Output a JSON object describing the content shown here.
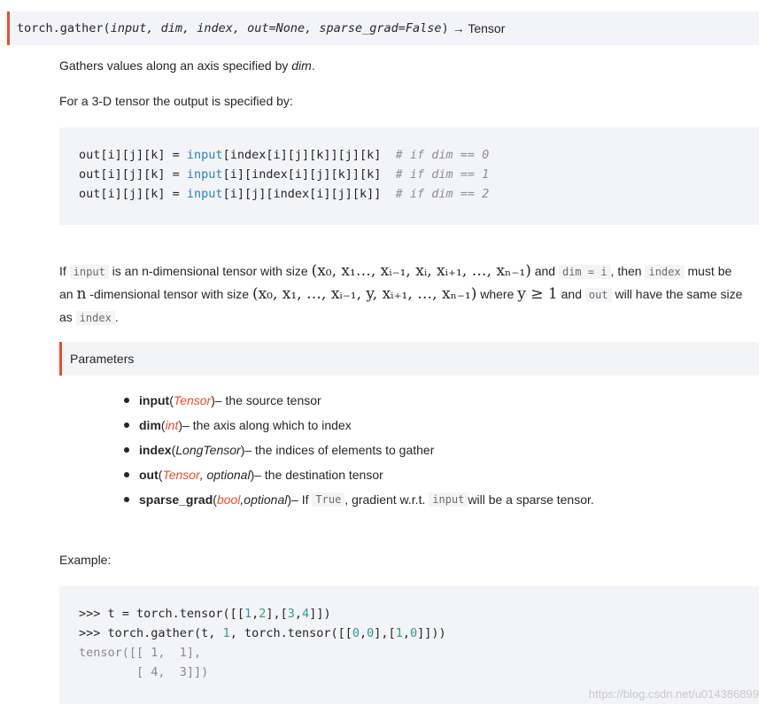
{
  "signature": {
    "name": "torch.gather",
    "open": "(",
    "args": "input, dim, index, out=None, sparse_grad=False",
    "close": ")",
    "returns": "→ Tensor"
  },
  "desc1_prefix": "Gathers values along an axis specified by ",
  "desc1_dim": "dim",
  "desc1_suffix": ".",
  "desc2": "For a 3-D tensor the output is specified by:",
  "code1": [
    {
      "lhs": "out[i][j][k] = ",
      "fn": "input",
      "rest": "[index[i][j][k]][j][k]  ",
      "comment": "# if dim == 0"
    },
    {
      "lhs": "out[i][j][k] = ",
      "fn": "input",
      "rest": "[i][index[i][j][k]][k]  ",
      "comment": "# if dim == 1"
    },
    {
      "lhs": "out[i][j][k] = ",
      "fn": "input",
      "rest": "[i][j][index[i][j][k]]  ",
      "comment": "# if dim == 2"
    }
  ],
  "para": {
    "t1": "If ",
    "c_input": "input",
    "t2": " is an n-dimensional tensor with size ",
    "math1": "(x₀, x₁…, xᵢ₋₁, xᵢ, xᵢ₊₁, …, xₙ₋₁)",
    "t3": " and ",
    "c_dim": "dim = i",
    "t4": ", then ",
    "c_index": "index",
    "t5": " must be",
    "t6": "an ",
    "math_n": "n",
    "t7": " -dimensional tensor with size ",
    "math2": "(x₀, x₁, …, xᵢ₋₁, y, xᵢ₊₁, …, xₙ₋₁)",
    "t8": " where ",
    "math3": "y ≥ 1",
    "t9": " and ",
    "c_out": "out",
    "t10": " will have the same size",
    "t11": "as ",
    "c_index2": "index",
    "t12": "."
  },
  "params_title": "Parameters",
  "params": [
    {
      "name": "input",
      "open": " (",
      "type": "Tensor",
      "type_link": true,
      "extra": "",
      "close": ")",
      "desc": " – the source tensor"
    },
    {
      "name": "dim",
      "open": " (",
      "type": "int",
      "type_link": true,
      "extra": "",
      "close": ")",
      "desc": " – the axis along which to index"
    },
    {
      "name": "index",
      "open": " (",
      "type": "LongTensor",
      "type_link": false,
      "extra": "",
      "close": ")",
      "desc": " – the indices of elements to gather"
    },
    {
      "name": "out",
      "open": " (",
      "type": "Tensor",
      "type_link": true,
      "extra": ", optional",
      "close": ")",
      "desc": " – the destination tensor"
    },
    {
      "name": "sparse_grad",
      "open": " (",
      "type": "bool",
      "type_link": true,
      "extra": ",optional",
      "close": ")",
      "desc": " – If "
    }
  ],
  "sparse_tail": {
    "c_true": "True",
    "t1": ", gradient w.r.t. ",
    "c_input": "input",
    "t2": " will be a sparse tensor."
  },
  "example_label": "Example:",
  "code2": {
    "l1_prompt": ">>> ",
    "l1_a": "t = torch.tensor([[",
    "l1_n1": "1",
    "l1_b": ",",
    "l1_n2": "2",
    "l1_c": "],[",
    "l1_n3": "3",
    "l1_d": ",",
    "l1_n4": "4",
    "l1_e": "]])",
    "l2_prompt": ">>> ",
    "l2_a": "torch.gather(t, ",
    "l2_n1": "1",
    "l2_b": ", torch.tensor([[",
    "l2_n2": "0",
    "l2_c": ",",
    "l2_n3": "0",
    "l2_d": "],[",
    "l2_n4": "1",
    "l2_e": ",",
    "l2_n5": "0",
    "l2_f": "]]))",
    "l3": "tensor([[ 1,  1],",
    "l4": "        [ 4,  3]])"
  },
  "watermark": "https://blog.csdn.net/u014386899"
}
